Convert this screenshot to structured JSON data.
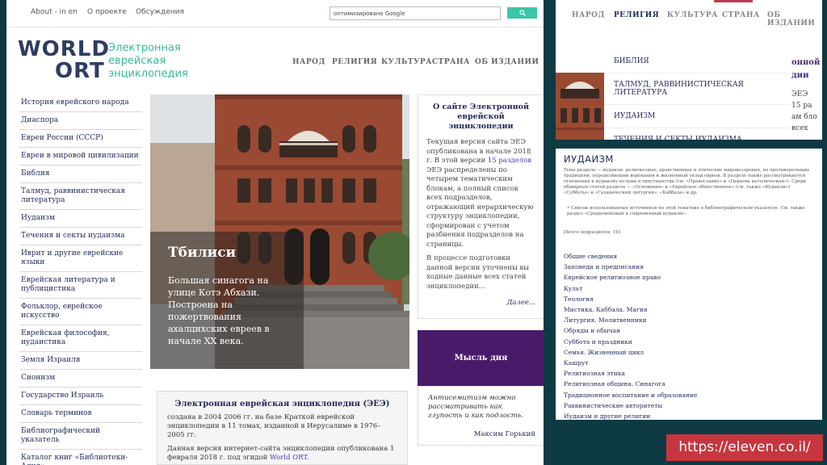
{
  "topbar": {
    "links": [
      "About - in en",
      "О проекте",
      "Обсуждения"
    ],
    "search_placeholder": "оптимизировано Google"
  },
  "logo": {
    "world": "WORLD",
    "ort": "ORT",
    "tagline": "Электронная еврейская энциклопедия"
  },
  "nav": [
    "НАРОД",
    "РЕЛИГИЯ",
    "КУЛЬТУРА",
    "СТРАНА",
    "ОБ ИЗДАНИИ"
  ],
  "sidebar": [
    "История еврейского народа",
    "Диаспора",
    "Евреи России (СССР)",
    "Евреи в мировой цивилизации",
    "Библия",
    "Талмуд, раввинистическая литература",
    "Иудаизм",
    "Течения и секты иудаизма",
    "Иврит и другие еврейские языки",
    "Еврейская литература и публицистика",
    "Фольклор, еврейское искусство",
    "Еврейская философия, иудаистика",
    "Земля Израиля",
    "Сионизм",
    "Государство Израиль",
    "Словарь терминов",
    "Библиографический указатель",
    "Каталог книг «Библиотеки-Алия»"
  ],
  "hero": {
    "title": "Тбилиси",
    "description": "Большая синагога на улице Котэ Абхази. Построена на пожертвования ахалцихских евреев в начале XX века."
  },
  "about": {
    "title": "О сайте Электронной еврейской энциклопедии",
    "p1_before": "Текущая версия сайта ЭЕЭ опубликована в начале 2018 г. В этой версии ",
    "p1_link": "15 разделов",
    "p1_after": " ЭЕЭ распределены по четырем тематическим блокам, а полный список всех подразделов, отражающий иерархическую структуру энциклопедии, сформирован с учетом разбиения подразделов на страницы.",
    "p2": "В процессе подготовки данной версии уточнены вы ходные данные всех статей энциклопедии...",
    "more": "Далее..."
  },
  "quote": {
    "heading": "Мысль дня",
    "text": "Антисемитизм можно рассматривать как глупость и как подлость.",
    "author": "Максим Горький"
  },
  "ej": {
    "title": "Электронная еврейская энциклопедия (ЭЕЭ)",
    "p1": "создана в 2004 2006 гг. на базе Краткой еврейской энциклопедии в 11 томах, изданной в Иерусалиме в 1976–2005 гг.",
    "p2_before": "Данная версия интернет-сайта энциклопедии опубликована 1 февраля 2018 г. под эгидой ",
    "p2_link": "World ORT",
    "p2_after": "."
  },
  "rtop": {
    "nav": [
      "НАРОД",
      "РЕЛИГИЯ",
      "КУЛЬТУРА",
      "СТРАНА",
      "ОБ ИЗДАНИИ"
    ],
    "menu": [
      "БИБЛИЯ",
      "ТАЛМУД, РАВВИНИСТИЧЕСКАЯ ЛИТЕРАТУРА",
      "ИУДАИЗМ",
      "ТЕЧЕНИЯ И СЕКТЫ ИУДАИЗМА"
    ],
    "edge_top": "онной",
    "edge_mid": "дии",
    "edge_line1": "ЭЕЭ",
    "edge_line2": "15 ра",
    "edge_line3": "ам бло",
    "edge_line4": "всех"
  },
  "rbot": {
    "title": "ИУДАИЗМ",
    "intro": "Тема раздела — иудаизм: религиозные, нравственные и этические мировоззрения, не противоречащие традициям, определяющим верования и жизненный уклад евреев. В разделе также рассматриваются отношения к иудаизму ислама и христианства (см. «Православие» и «Церковь католическая»). Среди обширных статей раздела — «Основания» и «Еврейское общественное» (см. также «Иудаизм») «Субботы» и «Галахический литургия», «Каббала» и др.",
    "bullet": "Список использованных источников по этой тематике в библиографическом указателе. См. также раздел «Средневековый и современный иудаизм».",
    "count": "[Всего подразделов: 16]",
    "items": [
      "Общие сведения",
      "Заповеди и предписания",
      "Еврейское религиозное право",
      "Культ",
      "Теология",
      "Мистика. Каббала. Магия",
      "Литургия. Молитвенники",
      "Обряды и обычаи",
      "Суббота и праздники",
      "Семья. Жизненный цикл",
      "Кашрут",
      "Религиозная этика",
      "Религиозная община. Синагога",
      "Традиционное воспитание и образование",
      "Раввинистические авторитеты",
      "Иудаизм и другие религии"
    ]
  },
  "badge": "https://eleven.co.il/",
  "colors": {
    "navy": "#1f2a5a",
    "teal": "#3ab89b",
    "purple": "#4a1a6a",
    "accent_red": "#c7363e",
    "background": "#0e3a44"
  }
}
